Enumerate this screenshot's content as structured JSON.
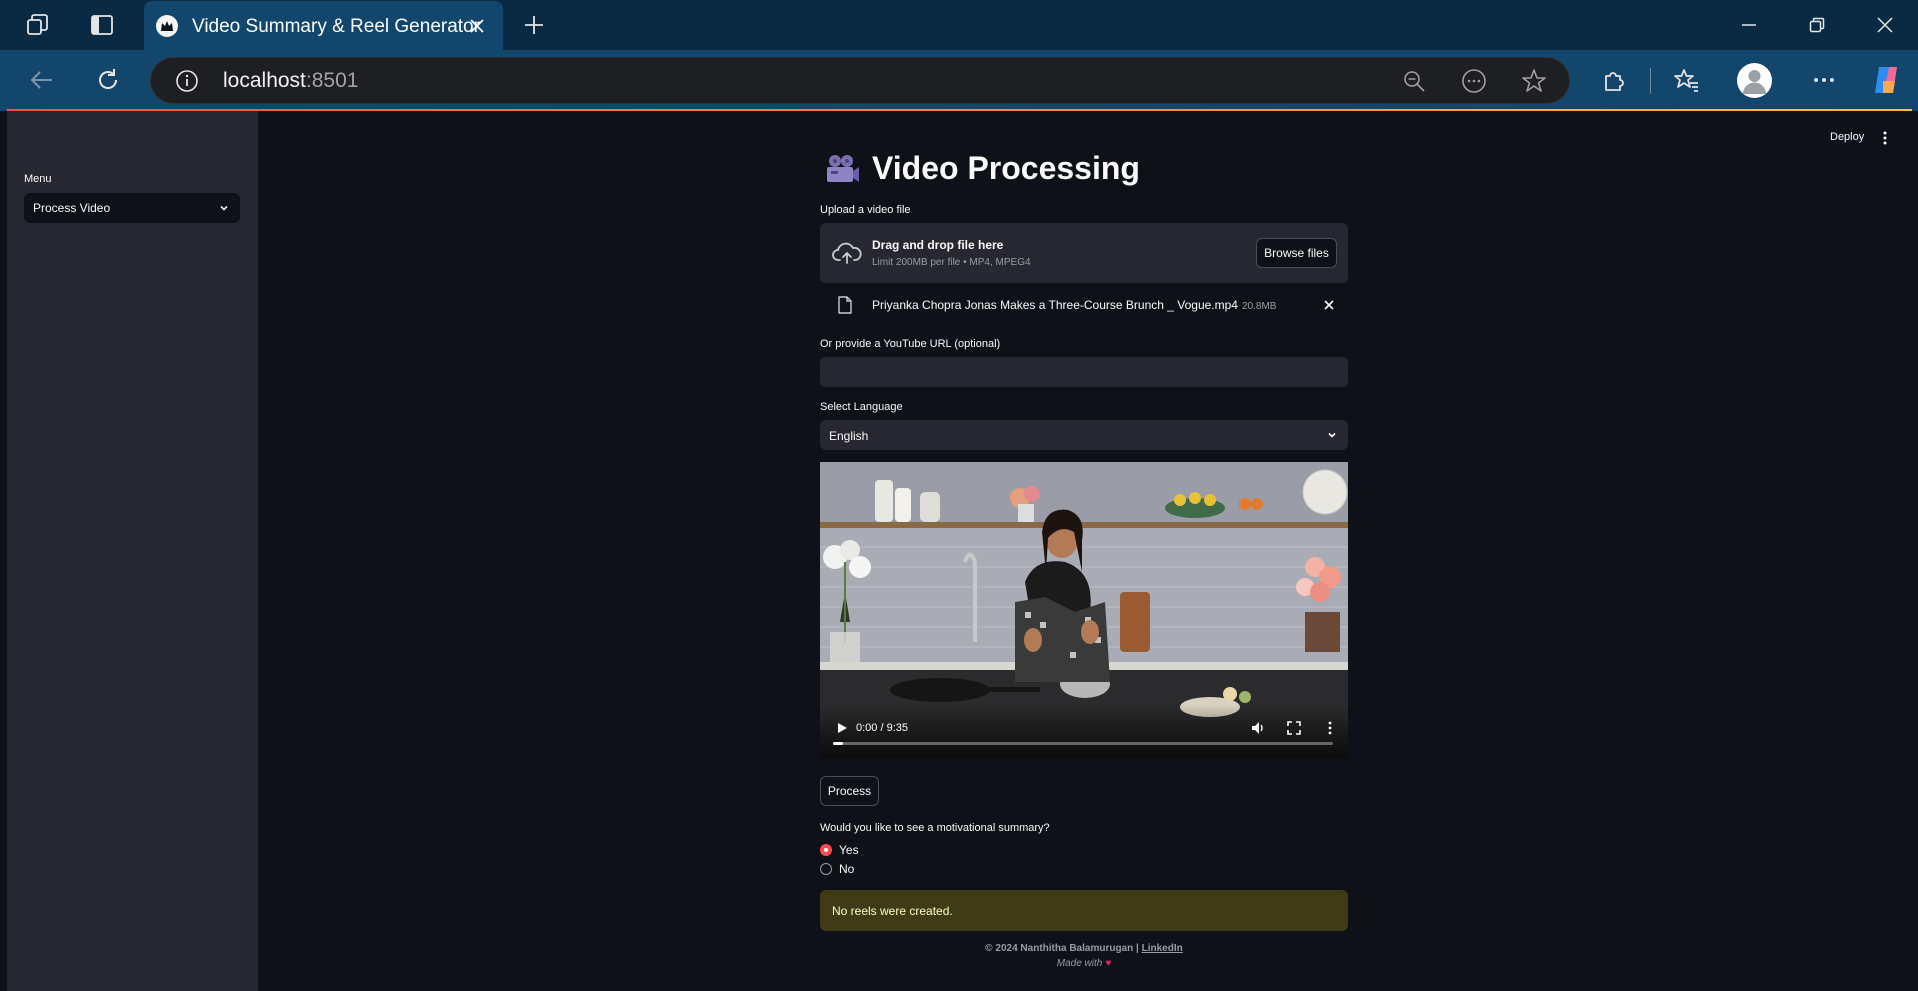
{
  "browser": {
    "tab_title": "Video Summary & Reel Generator",
    "url_host": "localhost",
    "url_port": ":8501"
  },
  "app": {
    "deploy_label": "Deploy",
    "sidebar": {
      "menu_label": "Menu",
      "menu_value": "Process Video"
    },
    "title": "Video Processing",
    "upload": {
      "label": "Upload a video file",
      "drag_text": "Drag and drop file here",
      "limit_text": "Limit 200MB per file • MP4, MPEG4",
      "browse_label": "Browse files",
      "file_name": "Priyanka Chopra Jonas Makes a Three-Course Brunch _ Vogue.mp4",
      "file_size": "20.8MB"
    },
    "youtube": {
      "label": "Or provide a YouTube URL (optional)",
      "value": ""
    },
    "language": {
      "label": "Select Language",
      "value": "English"
    },
    "video": {
      "time": "0:00 / 9:35",
      "progress": 0.02
    },
    "process_label": "Process",
    "question": "Would you like to see a motivational summary?",
    "options": [
      {
        "label": "Yes",
        "selected": true
      },
      {
        "label": "No",
        "selected": false
      }
    ],
    "alert": "No reels were created.",
    "footer": {
      "copyright": "© 2024 Nanthitha Balamurugan |",
      "link": "LinkedIn",
      "made_with": "Made with"
    }
  },
  "colors": {
    "primary": "#ff4b4b",
    "background": "#0e1117",
    "secondary_background": "#262730",
    "warning_bg": "#3e3b16",
    "warning_text": "#ffffc2"
  }
}
